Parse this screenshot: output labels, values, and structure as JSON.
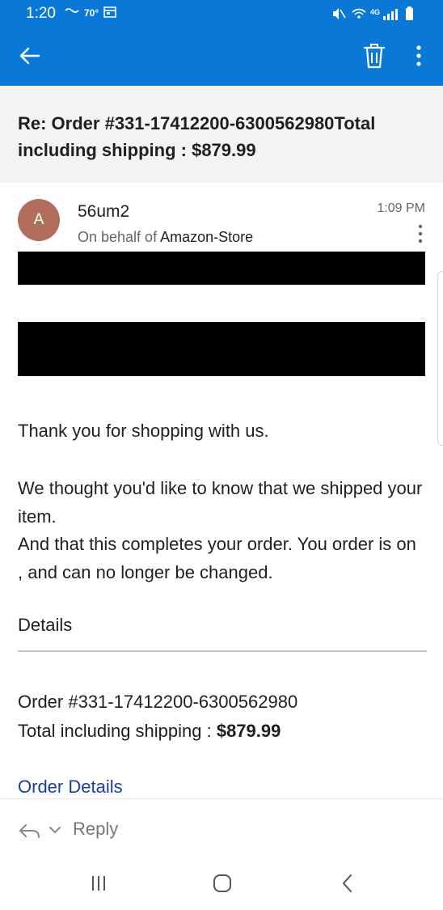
{
  "status_bar": {
    "time": "1:20",
    "temperature": "70°",
    "network": "4G"
  },
  "app_bar": {
    "back_icon": "arrow-left-icon",
    "delete_icon": "trash-icon",
    "more_icon": "more-vertical-icon",
    "color": "#0a78d7"
  },
  "email": {
    "subject": "Re: Order #331-17412200-6300562980Total including shipping : $879.99",
    "sender_initial": "A",
    "sender_name": "56um2",
    "on_behalf_prefix": "On behalf of ",
    "on_behalf_name": "Amazon-Store",
    "time": "1:09 PM",
    "avatar_color": "#b06e5c",
    "paragraphs": [
      "Thank you for shopping with us.",
      "We thought you'd like to know that we shipped your item.",
      "And that this completes your order. You order is on , and can no longer be changed."
    ],
    "details_heading": "Details",
    "order_line": "Order #331-17412200-6300562980",
    "total_prefix": "Total including shipping : ",
    "total_amount": "$879.99",
    "order_details_link": "Order Details"
  },
  "reply_bar": {
    "label": "Reply"
  },
  "nav_bar": {
    "recents_icon": "recents-icon",
    "home_icon": "home-icon",
    "back_icon": "back-chevron-icon"
  }
}
